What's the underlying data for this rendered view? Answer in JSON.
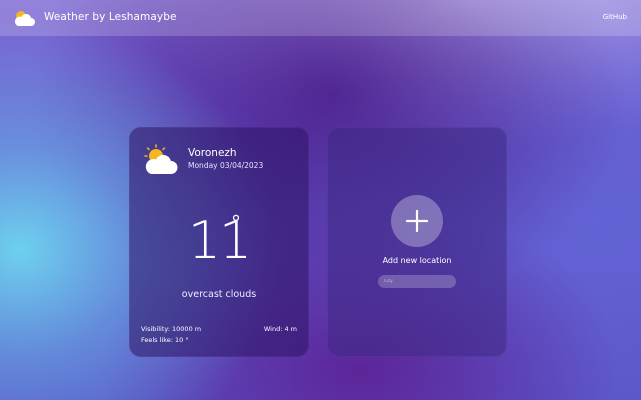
{
  "header": {
    "logo_icon": "sun-cloud-icon",
    "brand": "Weather by Leshamaybe",
    "github_link": "GitHub"
  },
  "weather_card": {
    "icon": "sun-cloud-icon",
    "city": "Voronezh",
    "date": "Monday 03/04/2023",
    "temperature": "11",
    "degree_symbol": "°",
    "description": "overcast clouds",
    "visibility": "Visibility: 10000 m",
    "feels_like": "Feels like: 10 °",
    "wind": "Wind: 4 m"
  },
  "add_card": {
    "button_icon": "plus-icon",
    "label": "Add new location",
    "input_placeholder": "City",
    "input_value": ""
  },
  "colors": {
    "header_bg": "rgba(255,255,255,0.18)",
    "card_bg": "#2d1464",
    "sun": "#f5b622",
    "text": "#ffffff"
  }
}
